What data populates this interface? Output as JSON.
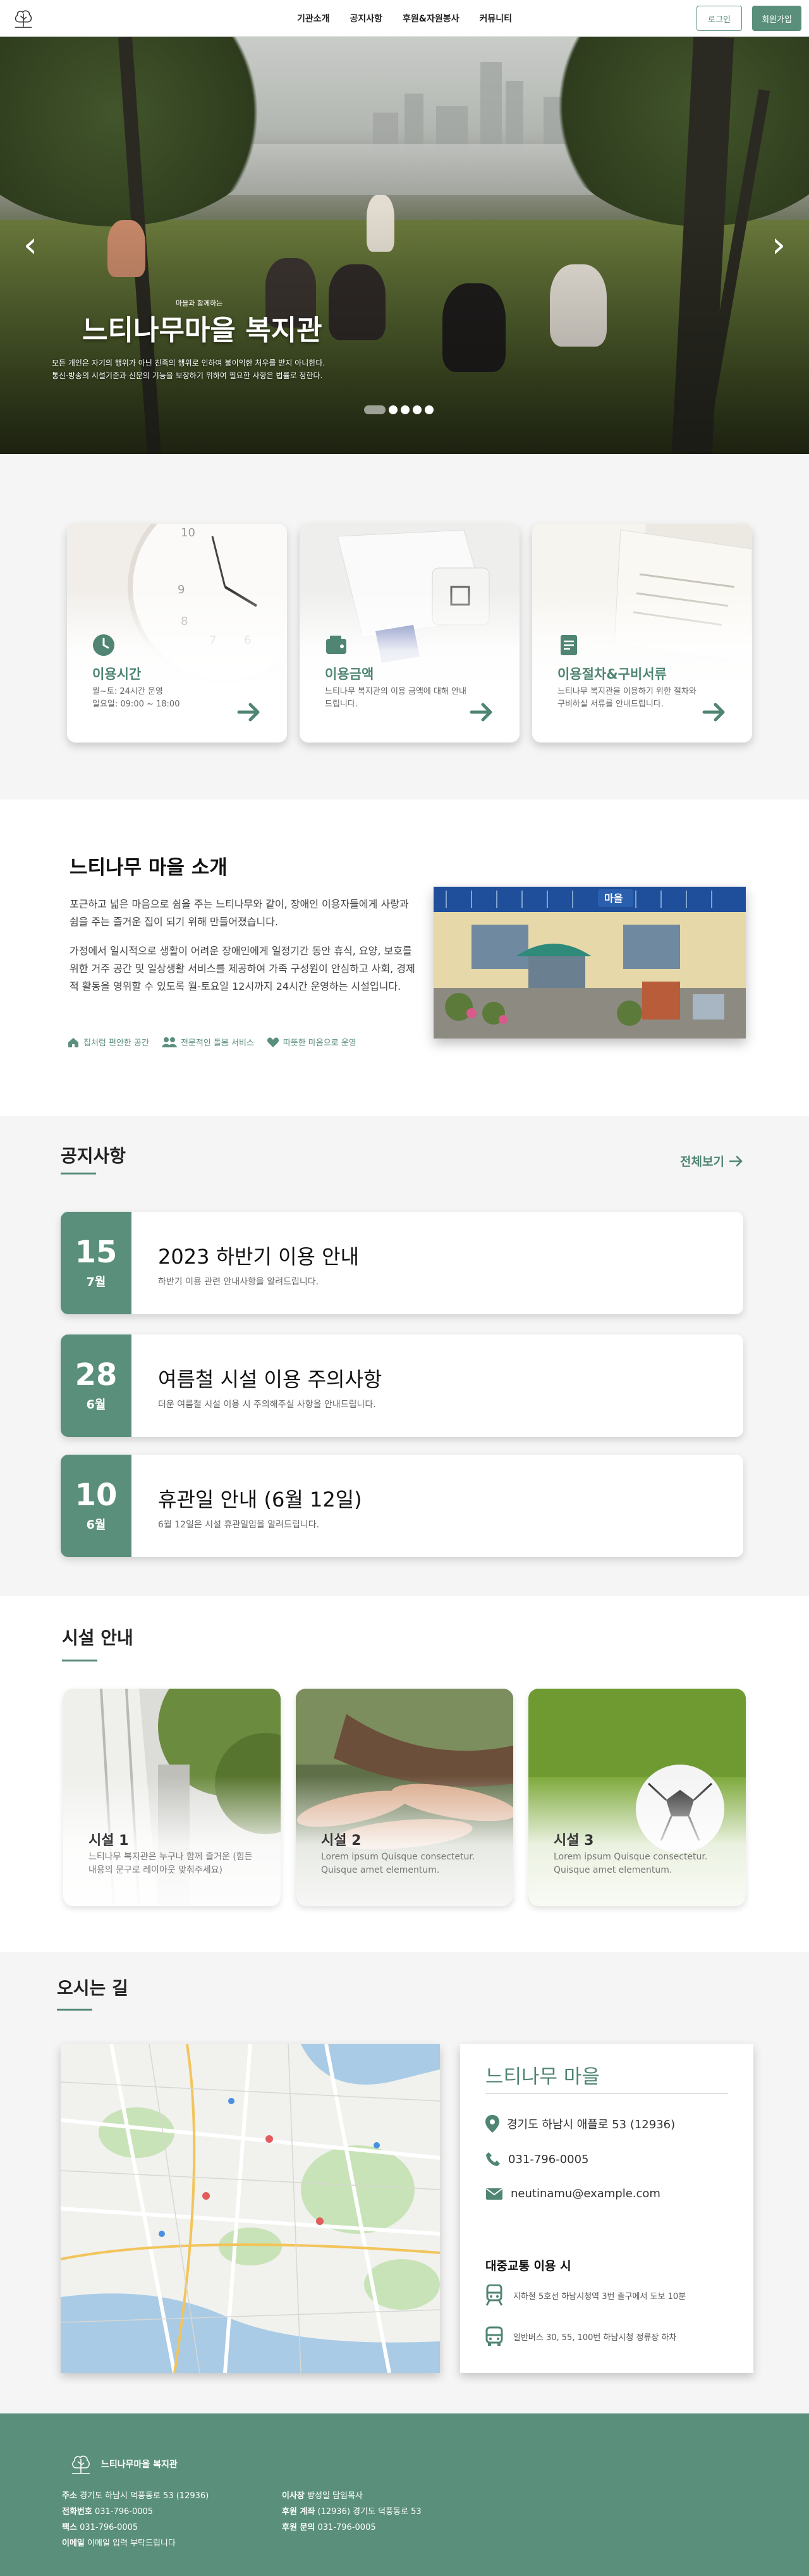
{
  "header": {
    "nav": [
      "기관소개",
      "공지사항",
      "후원&자원봉사",
      "커뮤니티"
    ],
    "login": "로그인",
    "signup": "회원가입"
  },
  "hero": {
    "subtitle": "마을과 함께하는",
    "title": "느티나무마을 복지관",
    "desc1": "모든 개인은 자기의 행위가 아닌 친족의 행위로 인하여 불이익한 처우를 받지 아니한다.",
    "desc2": "통신·방송의 시설기준과 신문의 기능을 보장하기 위하여 필요한 사항은 법률로 정한다."
  },
  "cards": [
    {
      "title": "이용시간",
      "desc": "월~토: 24시간 운영\n일요일: 09:00 ~ 18:00",
      "icon": "clock-icon"
    },
    {
      "title": "이용금액",
      "desc": "느티나무 복지관의 이용 금액에 대해 안내드립니다.",
      "icon": "wallet-icon"
    },
    {
      "title": "이용절차&구비서류",
      "desc": "느티나무 복지관을 이용하기 위한 절차와 구비하실 서류를 안내드립니다.",
      "icon": "document-icon"
    }
  ],
  "about": {
    "title": "느티나무 마을 소개",
    "p1": "포근하고 넓은 마음으로 쉼을 주는 느티나무와 같이, 장애인 이용자들에게 사랑과 쉼을 주는 즐거운 집이 되기 위해 만들어졌습니다.",
    "p2": "가정에서 일시적으로 생활이 어려운 장애인에게 일정기간 동안 휴식, 요양, 보호를 위한 거주 공간 및 일상생활 서비스를 제공하여 가족 구성원이 안심하고 사회, 경제적 활동을 영위할 수 있도록 월-토요일 12시까지 24시간 운영하는 시설입니다.",
    "features": [
      "집처럼 편안한 공간",
      "전문적인 돌봄 서비스",
      "따뜻한 마음으로 운영"
    ],
    "sign": "마을"
  },
  "notices": {
    "title": "공지사항",
    "see_all": "전체보기",
    "items": [
      {
        "day": "15",
        "month": "7월",
        "title": "2023 하반기 이용 안내",
        "desc": "하반기 이용 관련 안내사항을 알려드립니다."
      },
      {
        "day": "28",
        "month": "6월",
        "title": "여름철 시설 이용 주의사항",
        "desc": "더운 여름철 시설 이용 시 주의해주실 사항을 안내드립니다."
      },
      {
        "day": "10",
        "month": "6월",
        "title": "휴관일 안내 (6월 12일)",
        "desc": "6월 12일은 시설 휴관일임을 알려드립니다."
      }
    ]
  },
  "facilities": {
    "title": "시설 안내",
    "items": [
      {
        "title": "시설 1",
        "desc": "느티나무 복지관은 누구나 함께 즐거운 (힘든내용의 문구로 레이아웃 맞춰주세요)"
      },
      {
        "title": "시설 2",
        "desc": "Lorem ipsum Quisque consectetur. Quisque amet elementum."
      },
      {
        "title": "시설 3",
        "desc": "Lorem ipsum Quisque consectetur. Quisque amet elementum."
      }
    ]
  },
  "directions": {
    "title": "오시는 길",
    "name": "느티나무 마을",
    "address": "경기도 하남시 애플로 53 (12936)",
    "phone": "031-796-0005",
    "email": "neutinamu@example.com",
    "transit_title": "대중교통 이용 시",
    "subway": "지하철 5호선 하남시청역 3번 출구에서 도보 10분",
    "bus": "일반버스 30, 55, 100번 하남시청 정류장 하차"
  },
  "footer": {
    "name": "느티나무마을 복지관",
    "left": [
      {
        "k": "주소",
        "v": "경기도 하남시 덕풍동로 53 (12936)"
      },
      {
        "k": "전화번호",
        "v": "031-796-0005"
      },
      {
        "k": "팩스",
        "v": "031-796-0005"
      },
      {
        "k": "이메일",
        "v": "이메일 입력 부탁드립니다"
      }
    ],
    "right": [
      {
        "k": "이사장",
        "v": "방성일 담임목사"
      },
      {
        "k": "후원 계좌",
        "v": "(12936) 경기도 덕풍동로 53"
      },
      {
        "k": "후원 문의",
        "v": "031-796-0005"
      }
    ]
  },
  "colors": {
    "accent": "#5a8f7b",
    "accent_dark": "#4f8572",
    "section_bg": "#f5f5f5"
  }
}
